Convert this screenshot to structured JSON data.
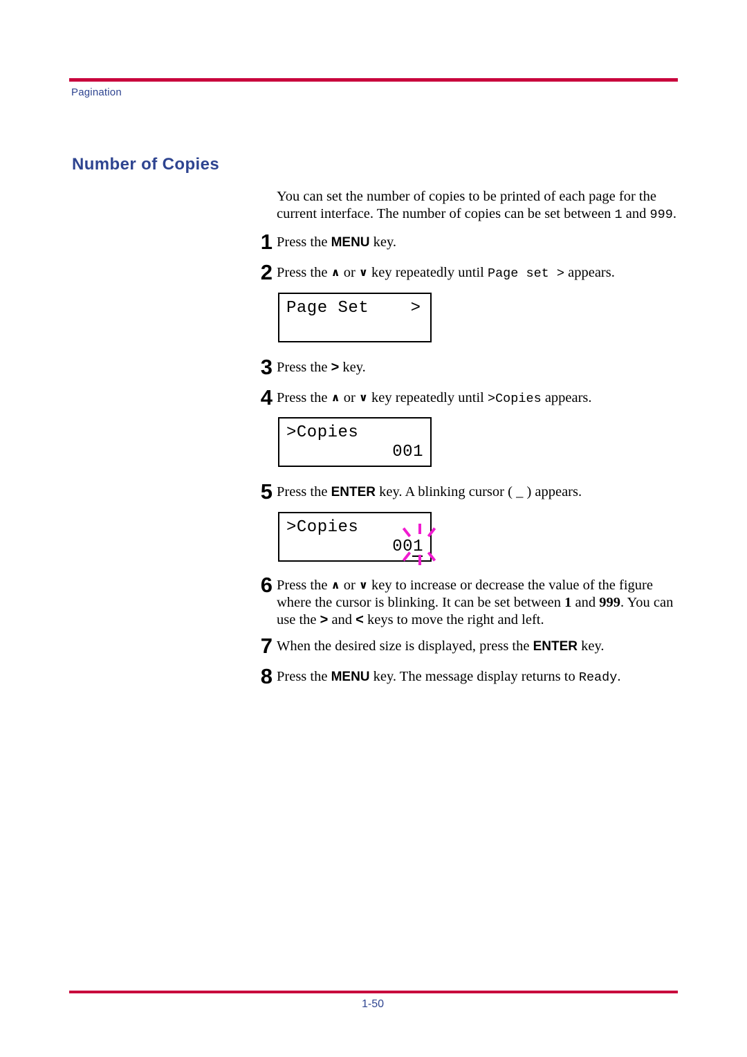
{
  "header": {
    "running_head": "Pagination",
    "rule_color": "#C8003C",
    "text_color": "#2E4490"
  },
  "section": {
    "title": "Number of Copies"
  },
  "intro": {
    "part1": "You can set the number of copies to be printed of each page for the current interface. The number of copies can be set between ",
    "min": "1",
    "part2": " and ",
    "max": "999",
    "part3": "."
  },
  "steps": [
    {
      "number": "1",
      "pre": "Press the ",
      "key": "MENU",
      "post": " key."
    },
    {
      "number": "2",
      "pre": "Press the ",
      "up": "∧",
      "mid": " or ",
      "down": "∨",
      "post": " key repeatedly until ",
      "display": "Page set >",
      "tail": " appears."
    },
    {
      "number": "3",
      "pre": "Press the ",
      "key": ">",
      "post": " key."
    },
    {
      "number": "4",
      "pre": "Press the ",
      "up": "∧",
      "mid": " or ",
      "down": "∨",
      "post": " key repeatedly until ",
      "display": ">Copies",
      "tail": " appears."
    },
    {
      "number": "5",
      "pre": "Press the ",
      "key": "ENTER",
      "post": " key. A blinking cursor ( ",
      "cursor": "_",
      "tail": " ) appears."
    },
    {
      "number": "6",
      "pre": "Press the ",
      "up": "∧",
      "mid": " or ",
      "down": "∨",
      "post": " key to increase or decrease the value of the figure where the cursor is blinking. It can be set between ",
      "min": "1",
      "between": " and ",
      "max": "999",
      "tail": ". You can use the ",
      "right_key": ">",
      "and": " and ",
      "left_key": "<",
      "end": " keys to move the right and left."
    },
    {
      "number": "7",
      "pre": "When the desired size is displayed, press the ",
      "key": "ENTER",
      "post": " key."
    },
    {
      "number": "8",
      "pre": "Press the ",
      "key": "MENU",
      "post": " key. The message display returns to ",
      "display": "Ready",
      "tail": "."
    }
  ],
  "lcd_panels": [
    {
      "id": "page-set",
      "line1_left": "Page Set",
      "line1_right": ">",
      "line2_right": ""
    },
    {
      "id": "copies-value",
      "line1_left": ">Copies",
      "line1_right": "",
      "line2_right": "001"
    },
    {
      "id": "copies-blinking",
      "line1_left": ">Copies",
      "line1_right": "",
      "line2_prefix": "00",
      "line2_blink_digit": "1",
      "blink_color": "#F01BD0"
    }
  ],
  "footer": {
    "page_number": "1-50",
    "rule_color": "#C8003C",
    "text_color": "#2E4490"
  }
}
